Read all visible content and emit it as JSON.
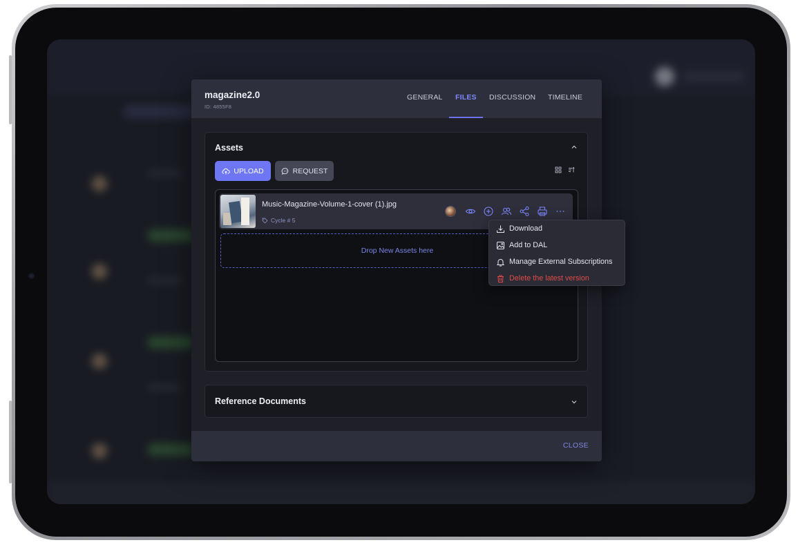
{
  "modal": {
    "title": "magazine2.0",
    "id_text": "ID: 4855F8",
    "tabs": [
      {
        "label": "GENERAL",
        "active": false
      },
      {
        "label": "FILES",
        "active": true
      },
      {
        "label": "DISCUSSION",
        "active": false
      },
      {
        "label": "TIMELINE",
        "active": false
      }
    ],
    "close_label": "CLOSE"
  },
  "assets": {
    "title": "Assets",
    "upload_label": "UPLOAD",
    "request_label": "REQUEST",
    "files": [
      {
        "name": "Music-Magazine-Volume-1-cover (1).jpg",
        "tag": "Cycle # 5"
      }
    ],
    "dropzone_text": "Drop New Assets here"
  },
  "reference": {
    "title": "Reference Documents"
  },
  "context_menu": {
    "items": [
      {
        "label": "Download",
        "icon": "download-icon"
      },
      {
        "label": "Add to DAL",
        "icon": "image-add-icon"
      },
      {
        "label": "Manage External Subscriptions",
        "icon": "bell-icon"
      },
      {
        "label": "Delete the latest version",
        "icon": "trash-icon",
        "danger": true
      }
    ]
  },
  "colors": {
    "accent": "#6e76f3",
    "danger": "#e24b4b",
    "modal_bg": "#1e1f27",
    "header_bg": "#2e2f3c"
  }
}
